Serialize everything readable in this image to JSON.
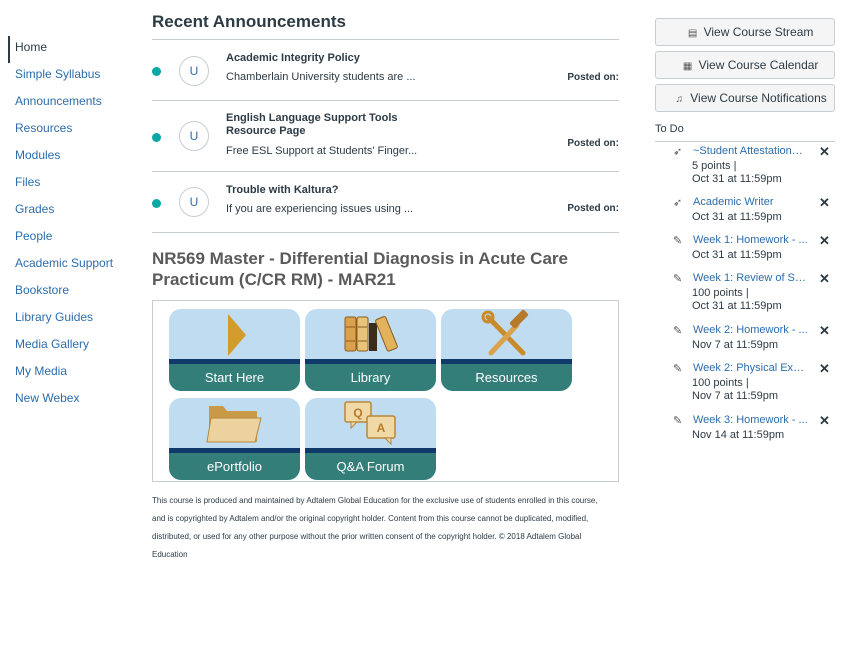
{
  "nav": {
    "items": [
      {
        "label": "Home"
      },
      {
        "label": "Simple Syllabus"
      },
      {
        "label": "Announcements"
      },
      {
        "label": "Resources"
      },
      {
        "label": "Modules"
      },
      {
        "label": "Files"
      },
      {
        "label": "Grades"
      },
      {
        "label": "People"
      },
      {
        "label": "Academic Support"
      },
      {
        "label": "Bookstore"
      },
      {
        "label": "Library Guides"
      },
      {
        "label": "Media Gallery"
      },
      {
        "label": "My Media"
      },
      {
        "label": "New Webex"
      }
    ]
  },
  "announcements": {
    "title": "Recent Announcements",
    "items": [
      {
        "avatar": "U",
        "title": "Academic Integrity Policy",
        "snippet": "Chamberlain University students are ...",
        "posted": "Posted on:"
      },
      {
        "avatar": "U",
        "title": "English Language Support Tools Resource Page",
        "snippet": "Free ESL Support at Students' Finger...",
        "posted": "Posted on:"
      },
      {
        "avatar": "U",
        "title": "Trouble with Kaltura?",
        "snippet": "If you are experiencing issues using ...",
        "posted": "Posted on:"
      }
    ]
  },
  "course": {
    "title": "NR569 Master - Differential Diagnosis in Acute Care Practicum (C/CR RM) - MAR21"
  },
  "tiles": [
    {
      "label": "Start Here",
      "icon": "play-arrow-icon"
    },
    {
      "label": "Library",
      "icon": "books-icon"
    },
    {
      "label": "Resources",
      "icon": "hammer-wrench-icon"
    },
    {
      "label": "ePortfolio",
      "icon": "folder-icon"
    },
    {
      "label": "Q&A Forum",
      "icon": "qa-bubbles-icon"
    }
  ],
  "footer": {
    "text": "This course is produced and maintained by Adtalem Global Education for the exclusive use of students enrolled in this course, and is copyrighted by Adtalem and/or the original copyright holder. Content from this course cannot be duplicated, modified, distributed, or used for any other purpose without the prior written consent of the copyright holder. © 2018 Adtalem Global Education"
  },
  "sidebar": {
    "buttons": [
      {
        "label": "View Course Stream",
        "icon": "stream-icon"
      },
      {
        "label": "View Course Calendar",
        "icon": "calendar-icon"
      },
      {
        "label": "View Course Notifications",
        "icon": "bell-icon"
      }
    ],
    "todo_title": "To Do",
    "todo": [
      {
        "icon": "rocket-icon",
        "title": "~Student Attestation~ ...",
        "line2": "5 points  |",
        "line3": "Oct 31 at 11:59pm"
      },
      {
        "icon": "rocket-icon",
        "title": "Academic Writer",
        "line2": "Oct 31 at 11:59pm",
        "line3": ""
      },
      {
        "icon": "assignment-icon",
        "title": "Week 1: Homework - ...",
        "line2": "Oct 31 at 11:59pm",
        "line3": ""
      },
      {
        "icon": "assignment-icon",
        "title": "Week 1: Review of Sys...",
        "line2": "100 points  |",
        "line3": "Oct 31 at 11:59pm"
      },
      {
        "icon": "assignment-icon",
        "title": "Week 2: Homework - ...",
        "line2": "Nov 7 at 11:59pm",
        "line3": ""
      },
      {
        "icon": "assignment-icon",
        "title": "Week 2: Physical Exam...",
        "line2": "100 points  |",
        "line3": "Nov 7 at 11:59pm"
      },
      {
        "icon": "assignment-icon",
        "title": "Week 3: Homework - ...",
        "line2": "Nov 14 at 11:59pm",
        "line3": ""
      }
    ],
    "dismiss_glyph": "✕"
  }
}
